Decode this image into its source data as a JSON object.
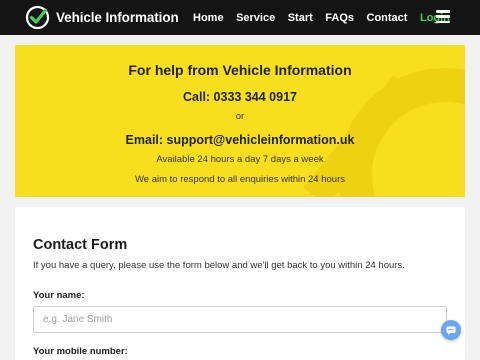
{
  "header": {
    "brand": "Vehicle Information",
    "nav": [
      {
        "label": "Home"
      },
      {
        "label": "Service"
      },
      {
        "label": "Start"
      },
      {
        "label": "FAQs"
      },
      {
        "label": "Contact"
      }
    ],
    "login_label": "Login"
  },
  "help": {
    "title": "For help from Vehicle Information",
    "call": "Call: 0333 344 0917",
    "or": "or",
    "email": "Email: support@vehicleinformation.uk",
    "availability": "Available 24 hours a day 7 days a week",
    "response": "We aim to respond to all enquiries within 24 hours"
  },
  "form": {
    "title": "Contact Form",
    "description": "If you have a query, please use the form below and we'll get back to you within 24 hours.",
    "name_label": "Your name:",
    "name_placeholder": "e.g. Jane Smith",
    "mobile_label": "Your mobile number:"
  },
  "colors": {
    "header_bg": "#141414",
    "accent_green": "#3bd35a",
    "banner_yellow": "#f7df1e",
    "chat_blue": "#6aa7ee"
  },
  "icons": {
    "logo": "checkmark-badge-icon",
    "menu": "hamburger-menu-icon",
    "chat": "chat-bubble-icon"
  }
}
